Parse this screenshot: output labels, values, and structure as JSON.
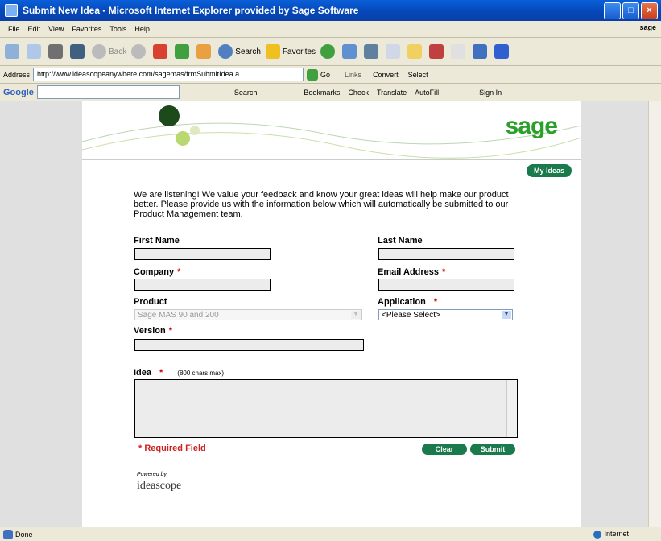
{
  "window": {
    "title": "Submit New Idea - Microsoft Internet Explorer provided by Sage Software"
  },
  "menu": {
    "items": [
      "File",
      "Edit",
      "View",
      "Favorites",
      "Tools",
      "Help"
    ],
    "brand": "sage"
  },
  "toolbar": {
    "back": "Back",
    "search": "Search",
    "favorites": "Favorites"
  },
  "address": {
    "label": "Address",
    "url": "http://www.ideascopeanywhere.com/sagemas/frmSubmitIdea.a",
    "go": "Go",
    "links": "Links",
    "convert": "Convert",
    "select": "Select"
  },
  "google": {
    "label": "Google",
    "search": "Search",
    "bookmarks": "Bookmarks",
    "check": "Check",
    "translate": "Translate",
    "autofill": "AutoFill",
    "signin": "Sign In"
  },
  "page": {
    "logo": "sage",
    "my_ideas": "My Ideas",
    "intro": "We are listening! We value your feedback and know your great ideas will help make our product better.  Please provide us with the information below which will automatically be submitted to our Product Management team.",
    "labels": {
      "first_name": "First Name",
      "last_name": "Last Name",
      "company": "Company",
      "email": "Email Address",
      "product": "Product",
      "application": "Application",
      "version": "Version",
      "idea": "Idea",
      "idea_hint": "(800 chars max)"
    },
    "required_marker": "*",
    "product_value": "Sage MAS 90 and 200",
    "application_value": "<Please Select>",
    "required_note": "* Required Field",
    "clear": "Clear",
    "submit": "Submit",
    "powered_by": "Powered by",
    "ideascope": "ideascope"
  },
  "status": {
    "left": "Done",
    "right": "Internet"
  }
}
